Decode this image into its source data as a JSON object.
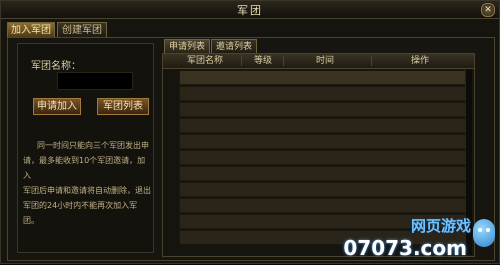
{
  "window": {
    "title": "军团",
    "close_icon": "close-icon"
  },
  "tabs": [
    {
      "label": "加入军团",
      "active": true
    },
    {
      "label": "创建军团",
      "active": false
    }
  ],
  "left": {
    "name_label": "军团名称：",
    "name_value": "",
    "apply_button": "申请加入",
    "list_button": "军团列表",
    "info_lines": [
      "同一时间只能向三个军团发出申",
      "请，最多能收到10个军团邀请，加入",
      "军团后申请和邀请将自动删除，退出",
      "军团的24小时内不能再次加入军团。"
    ]
  },
  "right": {
    "tabs": [
      {
        "label": "申请列表",
        "active": true
      },
      {
        "label": "邀请列表",
        "active": false
      }
    ],
    "columns": [
      "军团名称",
      "等级",
      "时间",
      "操作"
    ],
    "rows": [
      "",
      "",
      "",
      "",
      "",
      "",
      "",
      "",
      "",
      "",
      ""
    ]
  },
  "watermark": {
    "line1": "网页游戏",
    "line2": "07073.com"
  }
}
